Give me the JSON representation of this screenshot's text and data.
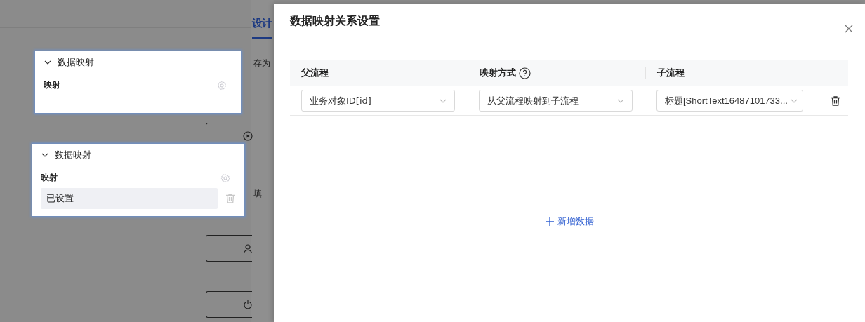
{
  "background": {
    "tab": "设计",
    "side_label": "存为",
    "side_label_2": "填",
    "cards": [
      {
        "title": "数据映射",
        "expanded": true,
        "field_label": "映射"
      },
      {
        "title": "数据映射",
        "expanded": true,
        "field_label": "映射",
        "value": "已设置"
      }
    ]
  },
  "drawer": {
    "title": "数据映射关系设置",
    "table": {
      "columns": [
        {
          "label": "父流程"
        },
        {
          "label": "映射方式",
          "help": true
        },
        {
          "label": "子流程"
        }
      ],
      "rows": [
        {
          "parent": "业务对象ID[id]",
          "mode": "从父流程映射到子流程",
          "child": "标题[ShortText16487101733..."
        }
      ]
    },
    "add_button": "新增数据"
  }
}
